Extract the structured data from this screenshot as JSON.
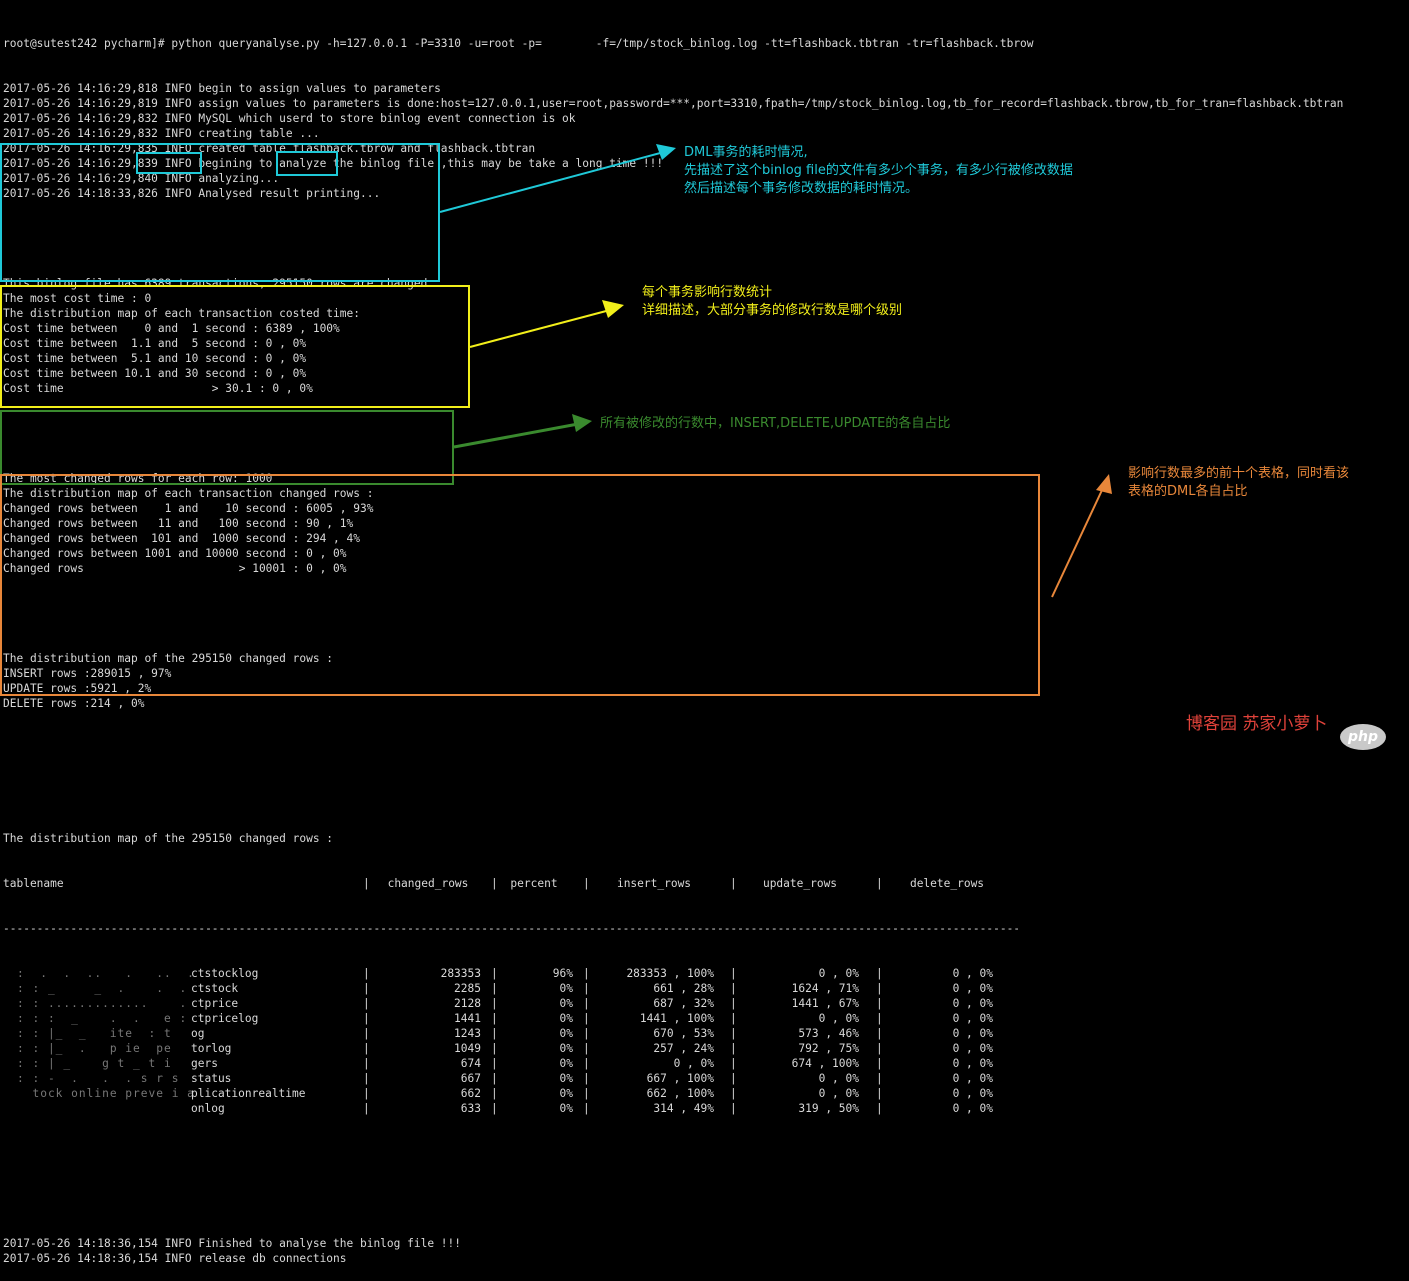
{
  "colors": {
    "background": "#000000",
    "text": "#d9d9d9",
    "cyan": "#1fc9d8",
    "yellow": "#f2ef1a",
    "green": "#3a8a2e",
    "orange": "#e8873a",
    "watermark": "#e0423a"
  },
  "terminal": {
    "prompt_line": "root@sutest242 pycharm]# python queryanalyse.py -h=127.0.0.1 -P=3310 -u=root -p=        -f=/tmp/stock_binlog.log -tt=flashback.tbtran -tr=flashback.tbrow",
    "log_lines": [
      "2017-05-26 14:16:29,818 INFO begin to assign values to parameters",
      "2017-05-26 14:16:29,819 INFO assign values to parameters is done:host=127.0.0.1,user=root,password=***,port=3310,fpath=/tmp/stock_binlog.log,tb_for_record=flashback.tbrow,tb_for_tran=flashback.tbtran",
      "2017-05-26 14:16:29,832 INFO MySQL which userd to store binlog event connection is ok",
      "2017-05-26 14:16:29,832 INFO creating table ...",
      "2017-05-26 14:16:29,835 INFO created table flashback.tbrow and flashback.tbtran",
      "2017-05-26 14:16:29,839 INFO begining to analyze the binlog file ,this may be take a long time !!!",
      "2017-05-26 14:16:29,840 INFO analyzing...",
      "2017-05-26 14:18:33,826 INFO Analysed result printing..."
    ],
    "cost_section": [
      "This binlog file has 6389 transactions, 295150 rows are changed",
      "The most cost time : 0",
      "The distribution map of each transaction costed time:",
      "Cost time between    0 and  1 second : 6389 , 100%",
      "Cost time between  1.1 and  5 second : 0 , 0%",
      "Cost time between  5.1 and 10 second : 0 , 0%",
      "Cost time between 10.1 and 30 second : 0 , 0%",
      "Cost time                      > 30.1 : 0 , 0%"
    ],
    "rows_section": [
      "The most changed rows for each row: 1000",
      "The distribution map of each transaction changed rows :",
      "Changed rows between    1 and    10 second : 6005 , 93%",
      "Changed rows between   11 and   100 second : 90 , 1%",
      "Changed rows between  101 and  1000 second : 294 , 4%",
      "Changed rows between 1001 and 10000 second : 0 , 0%",
      "Changed rows                       > 10001 : 0 , 0%"
    ],
    "dml_section": [
      "The distribution map of the 295150 changed rows :",
      "INSERT rows :289015 , 97%",
      "UPDATE rows :5921 , 2%",
      "DELETE rows :214 , 0%"
    ],
    "table_title": "The distribution map of the 295150 changed rows :",
    "table_headers": [
      "tablename",
      "changed_rows",
      "percent",
      "insert_rows",
      "update_rows",
      "delete_rows"
    ],
    "table_divider": "---------------------------------------------------------------------------------------------------------------------------------------------------------------",
    "table_rows": [
      {
        "blur": ":  .  .  ..   .   ..  .  ",
        "name": "ctstocklog",
        "changed": "283353",
        "percent": "96%",
        "insert": "283353 , 100%",
        "update": "0 , 0%",
        "delete": "0 , 0%"
      },
      {
        "blur": ": : _     _  .    .  .  ",
        "name": "ctstock",
        "changed": "2285",
        "percent": "0%",
        "insert": "661 , 28%",
        "update": "1624 , 71%",
        "delete": "0 , 0%"
      },
      {
        "blur": ": : .............    .  ",
        "name": "ctprice",
        "changed": "2128",
        "percent": "0%",
        "insert": "687 , 32%",
        "update": "1441 , 67%",
        "delete": "0 , 0%"
      },
      {
        "blur": ": : :  _    .  .   e : ",
        "name": "ctpricelog",
        "changed": "1441",
        "percent": "0%",
        "insert": "1441 , 100%",
        "update": "0 , 0%",
        "delete": "0 , 0%"
      },
      {
        "blur": ": : |_  _   ite  : t ",
        "name": "og",
        "changed": "1243",
        "percent": "0%",
        "insert": "670 , 53%",
        "update": "573 , 46%",
        "delete": "0 , 0%"
      },
      {
        "blur": ": : |_  .   p ie  pe ",
        "name": "torlog",
        "changed": "1049",
        "percent": "0%",
        "insert": "257 , 24%",
        "update": "792 , 75%",
        "delete": "0 , 0%"
      },
      {
        "blur": ": : | _    g t _ t i   ",
        "name": "gers",
        "changed": "674",
        "percent": "0%",
        "insert": "0 , 0%",
        "update": "674 , 100%",
        "delete": "0 , 0%"
      },
      {
        "blur": ": : -  .   .  . s r s ",
        "name": "status",
        "changed": "667",
        "percent": "0%",
        "insert": "667 , 100%",
        "update": "0 , 0%",
        "delete": "0 , 0%"
      },
      {
        "blur": "  tock online preve i a",
        "name": "plicationrealtime",
        "changed": "662",
        "percent": "0%",
        "insert": "662 , 100%",
        "update": "0 , 0%",
        "delete": "0 , 0%"
      },
      {
        "blur": "",
        "name": "onlog",
        "changed": "633",
        "percent": "0%",
        "insert": "314 , 49%",
        "update": "319 , 50%",
        "delete": "0 , 0%"
      }
    ],
    "final_lines": [
      "2017-05-26 14:18:36,154 INFO Finished to analyse the binlog file !!!",
      "2017-05-26 14:18:36,154 INFO release db connections"
    ]
  },
  "annotations": {
    "cyan_note": "DML事务的耗时情况,\n先描述了这个binlog file的文件有多少个事务，有多少行被修改数据\n然后描述每个事务修改数据的耗时情况。",
    "yellow_note": "每个事务影响行数统计\n详细描述，大部分事务的修改行数是哪个级别",
    "green_note": "所有被修改的行数中，INSERT,DELETE,UPDATE的各自占比",
    "orange_note": "影响行数最多的前十个表格，同时看该\n表格的DML各自占比"
  },
  "watermark": {
    "text": "博客园  苏家小萝卜",
    "logo": "php"
  }
}
